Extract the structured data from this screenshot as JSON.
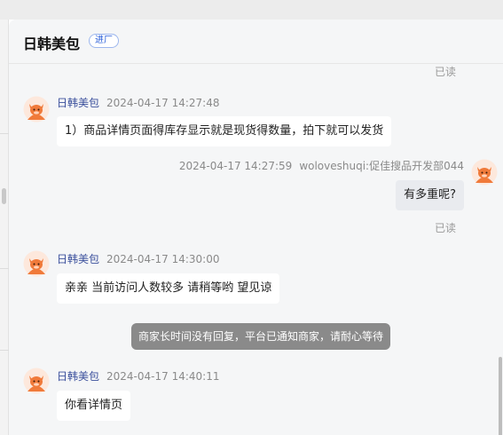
{
  "header": {
    "title": "日韩美包",
    "badge": "进厂"
  },
  "read_label": "已读",
  "messages": [
    {
      "sender": "日韩美包",
      "time": "2024-04-17 14:27:48",
      "text": "1）商品详情页面得库存显示就是现货得数量，拍下就可以发货"
    },
    {
      "sender": "wolovesh​uqi:促佳搜品开发部044",
      "time": "2024-04-17 14:27:59",
      "text": "有多重呢?"
    },
    {
      "sender": "日韩美包",
      "time": "2024-04-17 14:30:00",
      "text": "亲亲 当前访问人数较多 请稍等哟 望见谅"
    },
    {
      "sender": "日韩美包",
      "time": "2024-04-17 14:40:11",
      "text": "你看详情页"
    }
  ],
  "system_notice": "商家长时间没有回复，平台已通知商家，请耐心等待",
  "colors": {
    "accent_blue": "#2b5fd9",
    "system_notice_bg": "#8a8a8a",
    "avatar_orange": "#f07a3a"
  }
}
